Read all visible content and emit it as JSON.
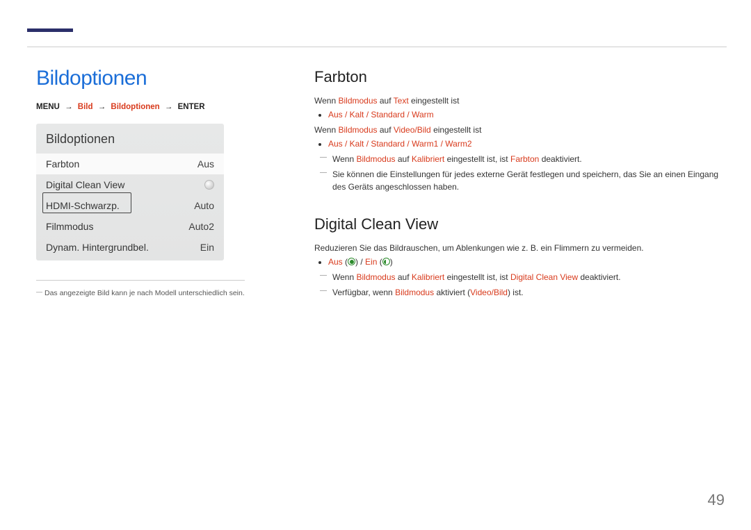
{
  "page_number": "49",
  "left": {
    "heading": "Bildoptionen",
    "breadcrumb": {
      "p1": "MENU",
      "p2": "Bild",
      "p3": "Bildoptionen",
      "p4": "ENTER"
    },
    "panel": {
      "title": "Bildoptionen",
      "rows": [
        {
          "label": "Farbton",
          "value": "Aus"
        },
        {
          "label": "Digital Clean View",
          "value": ""
        },
        {
          "label": "HDMI-Schwarzp.",
          "value": "Auto"
        },
        {
          "label": "Filmmodus",
          "value": "Auto2"
        },
        {
          "label": "Dynam. Hintergrundbel.",
          "value": "Ein"
        }
      ]
    },
    "footnote": "Das angezeigte Bild kann je nach Modell unterschiedlich sein."
  },
  "right": {
    "section1": {
      "heading": "Farbton",
      "line1_a": "Wenn",
      "line1_b": "Bildmodus",
      "line1_c": "auf",
      "line1_d": "Text",
      "line1_e": "eingestellt ist",
      "bullet1": "Aus / Kalt / Standard / Warm",
      "line2_a": "Wenn",
      "line2_b": "Bildmodus",
      "line2_c": "auf",
      "line2_d": "Video/Bild",
      "line2_e": "eingestellt ist",
      "bullet2": "Aus / Kalt / Standard / Warm1 / Warm2",
      "note1_a": "Wenn",
      "note1_b": "Bildmodus",
      "note1_c": "auf",
      "note1_d": "Kalibriert",
      "note1_e": "eingestellt ist, ist",
      "note1_f": "Farbton",
      "note1_g": "deaktiviert.",
      "note2": "Sie können die Einstellungen für jedes externe Gerät festlegen und speichern, das Sie an einen Eingang des Geräts angeschlossen haben."
    },
    "section2": {
      "heading": "Digital Clean View",
      "line1": "Reduzieren Sie das Bildrauschen, um Ablenkungen wie z. B. ein Flimmern zu vermeiden.",
      "bullet_a": "Aus",
      "bullet_b": "Ein",
      "note1_a": "Wenn",
      "note1_b": "Bildmodus",
      "note1_c": "auf",
      "note1_d": "Kalibriert",
      "note1_e": "eingestellt ist, ist",
      "note1_f": "Digital Clean View",
      "note1_g": "deaktiviert.",
      "note2_a": "Verfügbar, wenn",
      "note2_b": "Bildmodus",
      "note2_c": "aktiviert (",
      "note2_d": "Video/Bild",
      "note2_e": ") ist."
    }
  }
}
